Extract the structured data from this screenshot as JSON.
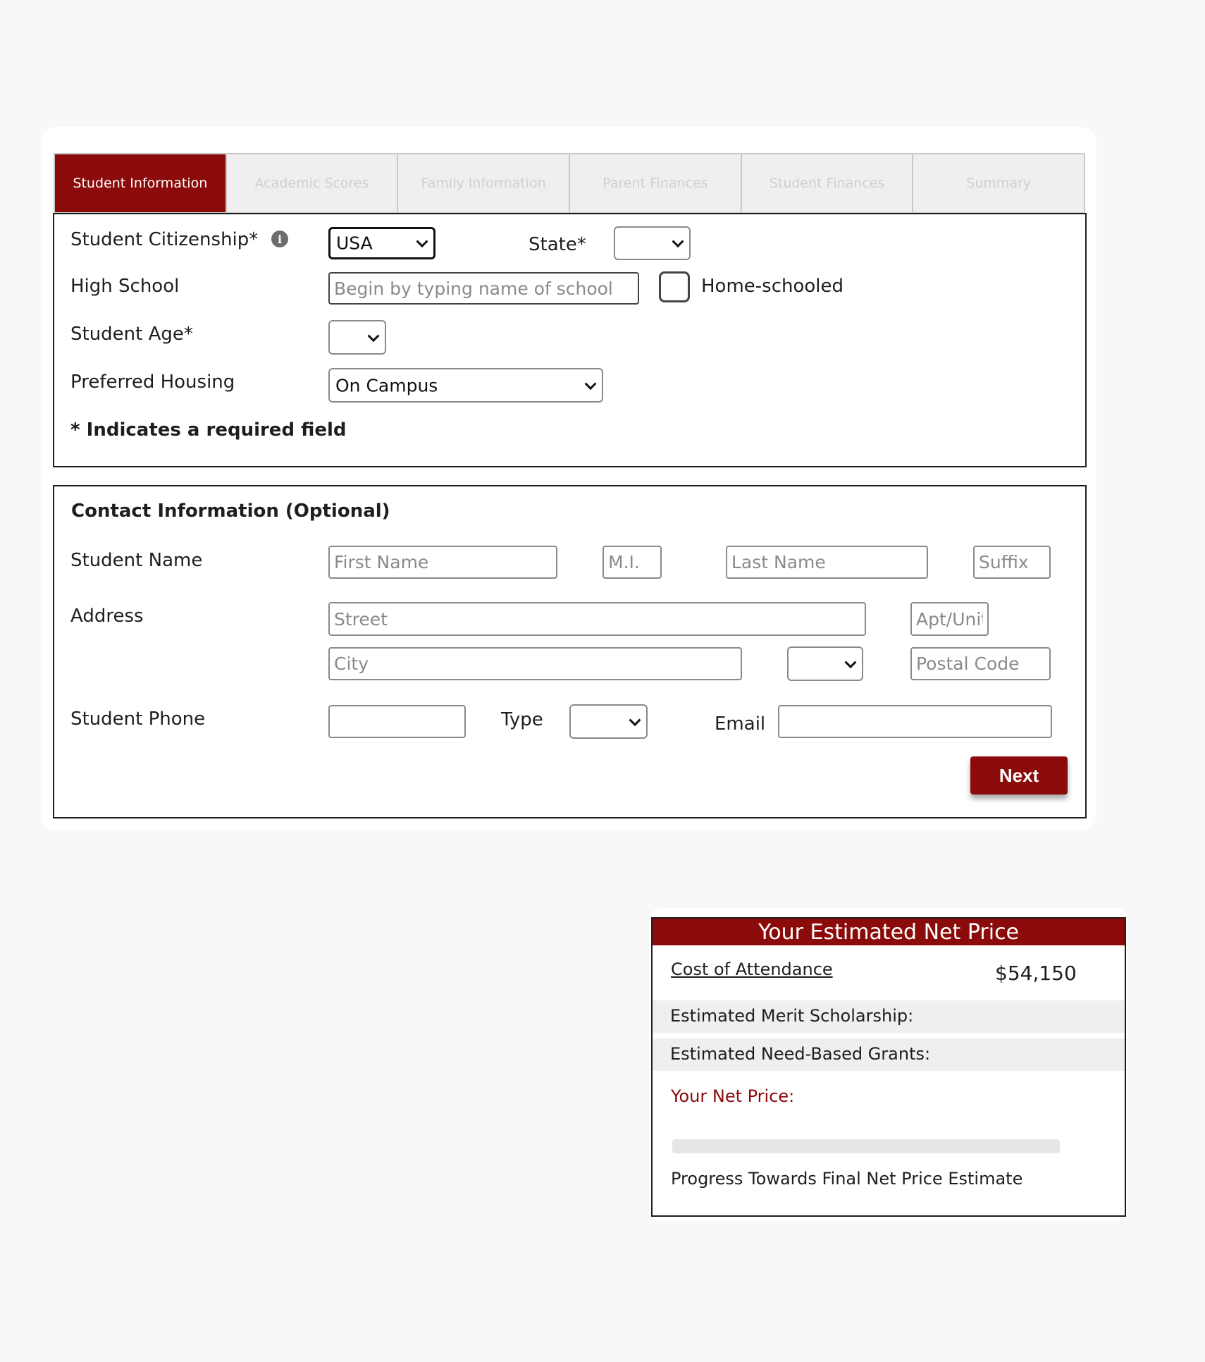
{
  "tabs": [
    {
      "label": "Student Information",
      "active": true
    },
    {
      "label": "Academic Scores",
      "active": false
    },
    {
      "label": "Family Information",
      "active": false
    },
    {
      "label": "Parent Finances",
      "active": false
    },
    {
      "label": "Student Finances",
      "active": false
    },
    {
      "label": "Summary",
      "active": false
    }
  ],
  "student_info": {
    "citizenship_label": "Student Citizenship*",
    "citizenship_value": "USA",
    "state_label": "State*",
    "state_value": "",
    "high_school_label": "High School",
    "high_school_placeholder": "Begin by typing name of school",
    "homeschooled_label": "Home-schooled",
    "age_label": "Student Age*",
    "age_value": "",
    "housing_label": "Preferred Housing",
    "housing_value": "On Campus",
    "required_note": "* Indicates a required field"
  },
  "contact": {
    "heading": "Contact Information (Optional)",
    "name_label": "Student Name",
    "first_placeholder": "First Name",
    "mi_placeholder": "M.I.",
    "last_placeholder": "Last Name",
    "suffix_placeholder": "Suffix",
    "address_label": "Address",
    "street_placeholder": "Street",
    "apt_placeholder": "Apt/Unit",
    "city_placeholder": "City",
    "state_value": "",
    "postal_placeholder": "Postal Code",
    "phone_label": "Student Phone",
    "type_label": "Type",
    "type_value": "",
    "email_label": "Email",
    "next_label": "Next"
  },
  "net_price": {
    "title": "Your Estimated Net Price",
    "cost_label": "Cost of Attendance",
    "cost_value": "$54,150",
    "merit_label": "Estimated Merit Scholarship:",
    "need_label": "Estimated Need-Based Grants:",
    "net_label": "Your Net Price:",
    "progress_percent": 0,
    "progress_label": "Progress Towards Final Net Price Estimate"
  },
  "colors": {
    "brand": "#8b0a0a",
    "muted_text": "#cfcfcf"
  }
}
